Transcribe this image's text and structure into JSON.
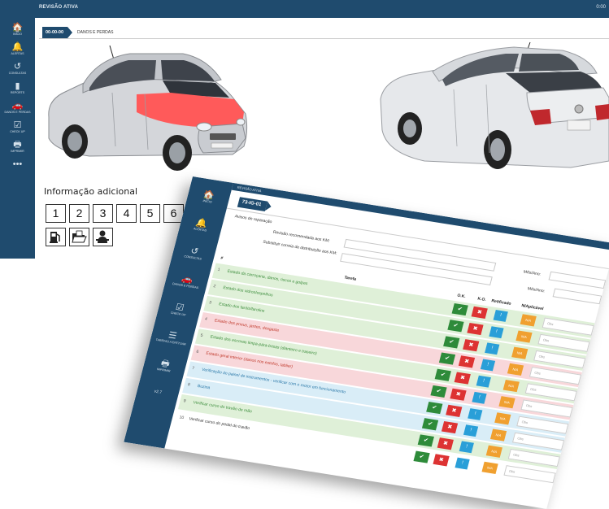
{
  "back": {
    "app_title": "REVISÃO ATIVA",
    "topbar_right": "0:00",
    "sidebar": [
      {
        "icon": "home-icon",
        "glyph": "🏠",
        "label": "INÍCIO"
      },
      {
        "icon": "bell-icon",
        "glyph": "🔔",
        "label": "ALERTAS"
      },
      {
        "icon": "history-icon",
        "glyph": "↺",
        "label": "CONSULTAS"
      },
      {
        "icon": "document-icon",
        "glyph": "▮",
        "label": "REPORTS"
      },
      {
        "icon": "car-icon",
        "glyph": "🚗",
        "label": "DANOS E PERDAS"
      },
      {
        "icon": "checklist-icon",
        "glyph": "☑",
        "label": "CHECK UP"
      },
      {
        "icon": "printer-icon",
        "glyph": "🖶",
        "label": "IMPRIMIR"
      },
      {
        "icon": "more-icon",
        "glyph": "•••",
        "label": ""
      }
    ],
    "plate_chip": "00-00-00",
    "breadcrumb_text": "DANOS E PERDAS",
    "info_title": "Informação adicional",
    "number_buttons": [
      "1",
      "2",
      "3",
      "4",
      "5",
      "6"
    ],
    "icon_buttons": [
      "fuel-pump-icon",
      "folder-icon",
      "mechanic-icon"
    ],
    "colors": {
      "navy": "#1f4b6e",
      "damage": "#ff5a5a"
    }
  },
  "front": {
    "app_title": "REVISÃO ATIVA",
    "plate_chip": "73-IG-01",
    "sidebar": [
      {
        "icon": "home-icon",
        "glyph": "🏠",
        "label": "INÍCIO"
      },
      {
        "icon": "bell-icon",
        "glyph": "🔔",
        "label": "ALERTAS"
      },
      {
        "icon": "history-icon",
        "glyph": "↺",
        "label": "CONSULTAS"
      },
      {
        "icon": "car-icon",
        "glyph": "🚗",
        "label": "DANOS E PERDAS"
      },
      {
        "icon": "checklist-icon",
        "glyph": "☑",
        "label": "CHECK UP"
      },
      {
        "icon": "list-icon",
        "glyph": "☰",
        "label": "TAREFAS A EFETUAR"
      },
      {
        "icon": "printer-icon",
        "glyph": "🖶",
        "label": "IMPRIMIR"
      },
      {
        "icon": "version-text",
        "glyph": "v2.7",
        "label": ""
      }
    ],
    "avisos_label": "Avisos de reparação",
    "revisao_label": "Revisão recomendada aos KM:",
    "correia_label": "Substituir correia de distribuição aos KM:",
    "mes_ano_label_1": "Mês/Ano:",
    "mes_ano_label_2": "Mês/Ano:",
    "col_hash": "#",
    "col_tarefa": "Tarefa",
    "col_ok": "O.K.",
    "col_ko": "K.O.",
    "col_retificado": "Retificado",
    "col_naplicavel": "N/Aplicável",
    "btn_ok": "✔",
    "btn_ko": "✖",
    "btn_retificado": "!",
    "btn_na": "N/A",
    "obs_placeholder": "Obs",
    "tasks": [
      {
        "num": "1",
        "text": "Estado da carroçaria, danos, riscos e golpes",
        "status": "ok"
      },
      {
        "num": "2",
        "text": "Estado dos vidros/espelhos",
        "status": "ok"
      },
      {
        "num": "3",
        "text": "Estado dos faróis/farolins",
        "status": "ok"
      },
      {
        "num": "4",
        "text": "Estado dos pneus, jantes, desgaste",
        "status": "ko"
      },
      {
        "num": "5",
        "text": "Estado dos escovas limpa-pára-brisas (dianteiro e traseiro)",
        "status": "ok"
      },
      {
        "num": "6",
        "text": "Estado geral interior (danos nos estofos, tablier)",
        "status": "ko"
      },
      {
        "num": "7",
        "text": "Verificação do painel de instrumentos - verificar com o motor em funcionamento",
        "status": "info"
      },
      {
        "num": "8",
        "text": "Buzina",
        "status": "info"
      },
      {
        "num": "9",
        "text": "Verificar curso do travão de mão",
        "status": "ok"
      },
      {
        "num": "10",
        "text": "Verificar curso do pedal do travão",
        "status": "none"
      }
    ],
    "row_colors": {
      "ok": "#dff0d8",
      "ko": "#f8d7da",
      "info": "#d9edf7",
      "none": "#ffffff"
    }
  }
}
